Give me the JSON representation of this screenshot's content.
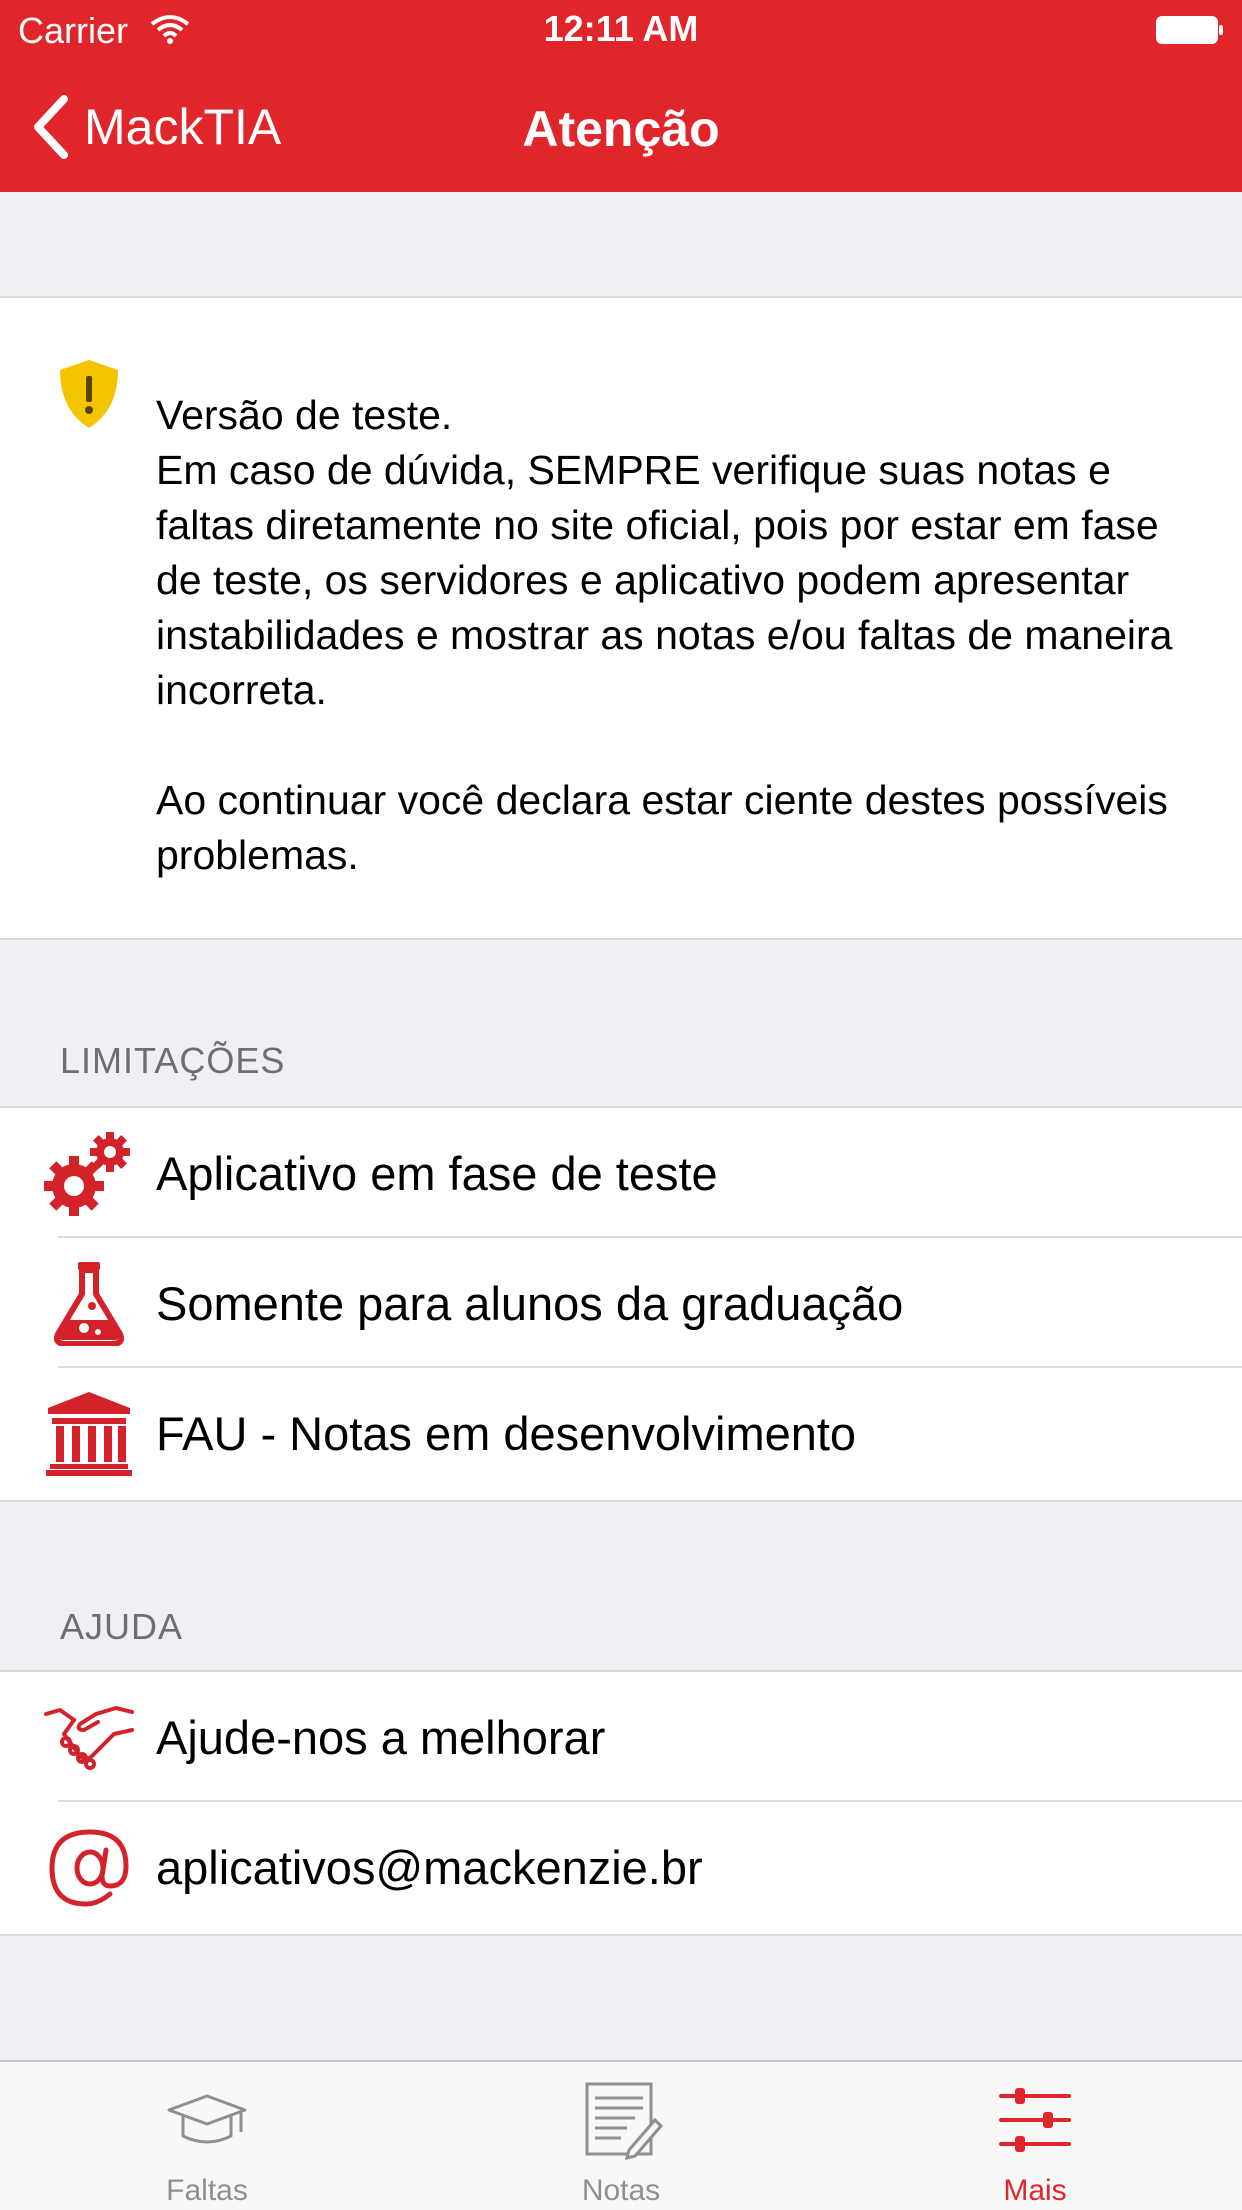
{
  "status_bar": {
    "carrier": "Carrier",
    "time": "12:11 AM"
  },
  "nav": {
    "back_label": "MackTIA",
    "title": "Atenção"
  },
  "notice": {
    "line1": "Versão de teste.",
    "paragraph1": "Em caso de dúvida, SEMPRE verifique suas notas e faltas diretamente no site oficial, pois por estar em fase de teste, os servidores e aplicativo podem apresentar instabilidades e mostrar as notas e/ou faltas de maneira incorreta.",
    "paragraph2": "Ao continuar você declara estar ciente destes possíveis problemas."
  },
  "limitations": {
    "header": "LIMITAÇÕES",
    "items": [
      {
        "label": "Aplicativo em fase de teste",
        "icon": "gears-icon"
      },
      {
        "label": "Somente para alunos da graduação",
        "icon": "flask-icon"
      },
      {
        "label": "FAU - Notas em desenvolvimento",
        "icon": "building-icon"
      }
    ]
  },
  "help": {
    "header": "AJUDA",
    "items": [
      {
        "label": "Ajude-nos a melhorar",
        "icon": "handshake-icon"
      },
      {
        "label": "aplicativos@mackenzie.br",
        "icon": "at-icon"
      }
    ]
  },
  "tabs": [
    {
      "label": "Faltas",
      "icon": "graduation-cap-icon"
    },
    {
      "label": "Notas",
      "icon": "document-pencil-icon"
    },
    {
      "label": "Mais",
      "icon": "sliders-icon",
      "active": true
    }
  ],
  "colors": {
    "accent": "#e0252b",
    "warning": "#f5c400",
    "background": "#efeff4",
    "tab_inactive": "#8e8e93"
  }
}
